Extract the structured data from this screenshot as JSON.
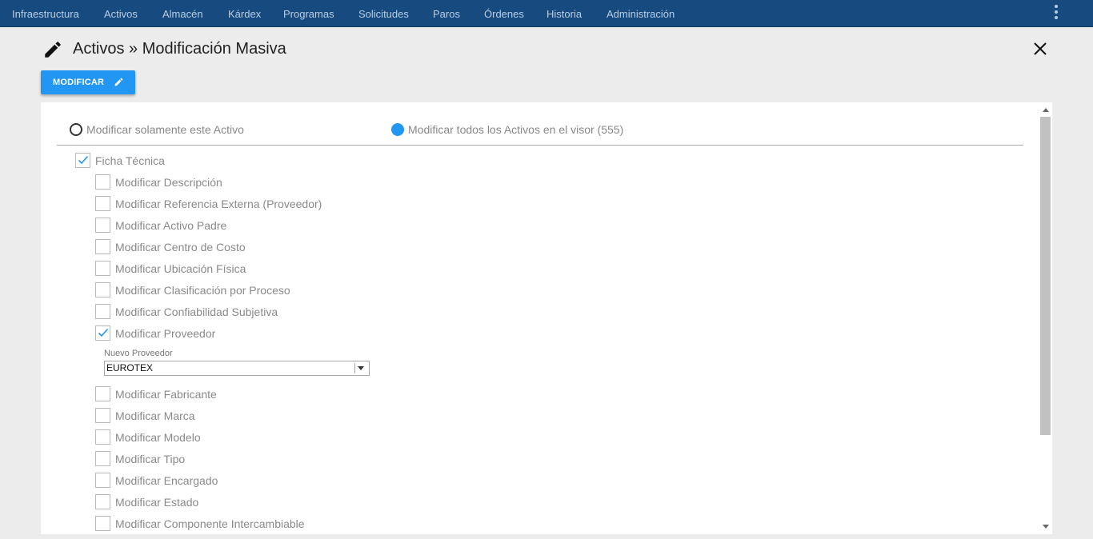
{
  "nav": {
    "items": [
      "Infraestructura",
      "Activos",
      "Almacén",
      "Kárdex",
      "Programas",
      "Solicitudes",
      "Paros",
      "Órdenes",
      "Historia",
      "Administración"
    ],
    "menu_icon": "kebab-vertical-icon"
  },
  "header": {
    "title": "Activos » Modificación Masiva",
    "title_icon": "pencil-icon",
    "close_icon": "close-icon"
  },
  "toolbar": {
    "modify_label": "MODIFICAR",
    "modify_icon": "pencil-icon"
  },
  "scope": {
    "options": [
      {
        "label": "Modificar solamente este Activo",
        "selected": false
      },
      {
        "label": "Modificar todos los Activos en el visor (555)",
        "selected": true
      }
    ]
  },
  "section": {
    "label": "Ficha Técnica",
    "checked": true
  },
  "options": [
    {
      "label": "Modificar Descripción",
      "checked": false
    },
    {
      "label": "Modificar Referencia Externa (Proveedor)",
      "checked": false
    },
    {
      "label": "Modificar Activo Padre",
      "checked": false
    },
    {
      "label": "Modificar Centro de Costo",
      "checked": false
    },
    {
      "label": "Modificar Ubicación Física",
      "checked": false
    },
    {
      "label": "Modificar Clasificación por Proceso",
      "checked": false
    },
    {
      "label": "Modificar Confiabilidad Subjetiva",
      "checked": false
    },
    {
      "label": "Modificar Proveedor",
      "checked": true
    },
    {
      "label": "Modificar Fabricante",
      "checked": false
    },
    {
      "label": "Modificar Marca",
      "checked": false
    },
    {
      "label": "Modificar Modelo",
      "checked": false
    },
    {
      "label": "Modificar Tipo",
      "checked": false
    },
    {
      "label": "Modificar Encargado",
      "checked": false
    },
    {
      "label": "Modificar Estado",
      "checked": false
    },
    {
      "label": "Modificar Componente Intercambiable",
      "checked": false
    }
  ],
  "provider_field": {
    "label": "Nuevo Proveedor",
    "value": "EUROTEX"
  },
  "colors": {
    "nav_bg": "#174b80",
    "accent": "#2196f3",
    "page_bg": "#ececec"
  }
}
